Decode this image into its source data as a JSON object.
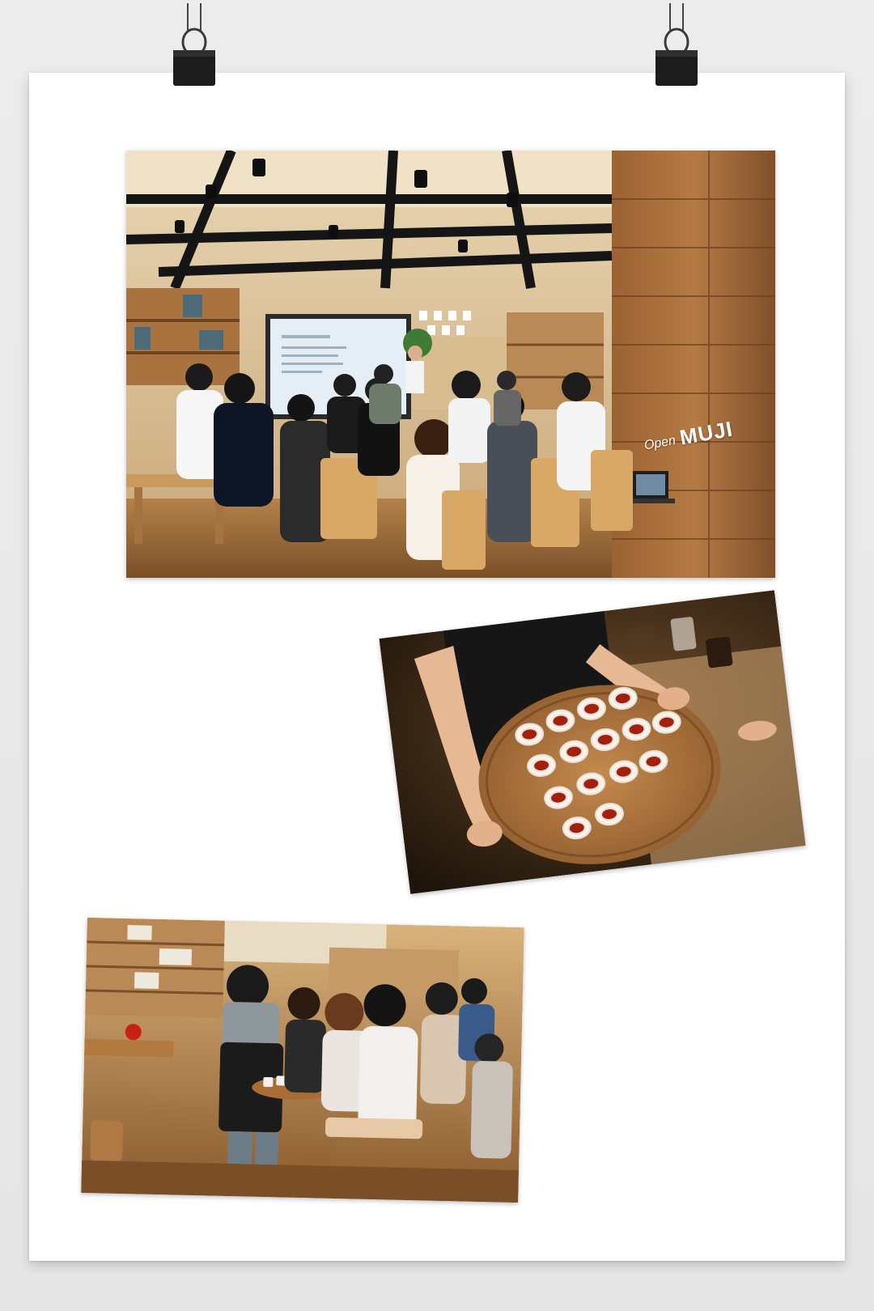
{
  "scene": {
    "sign_open": "Open",
    "sign_brand": "MUJI"
  },
  "colors": {
    "wall": "#e9e9e9",
    "poster": "#ffffff",
    "wood": "#a8733f",
    "clip": "#1c1c1c"
  },
  "icons": [
    "binder-clip-icon"
  ]
}
